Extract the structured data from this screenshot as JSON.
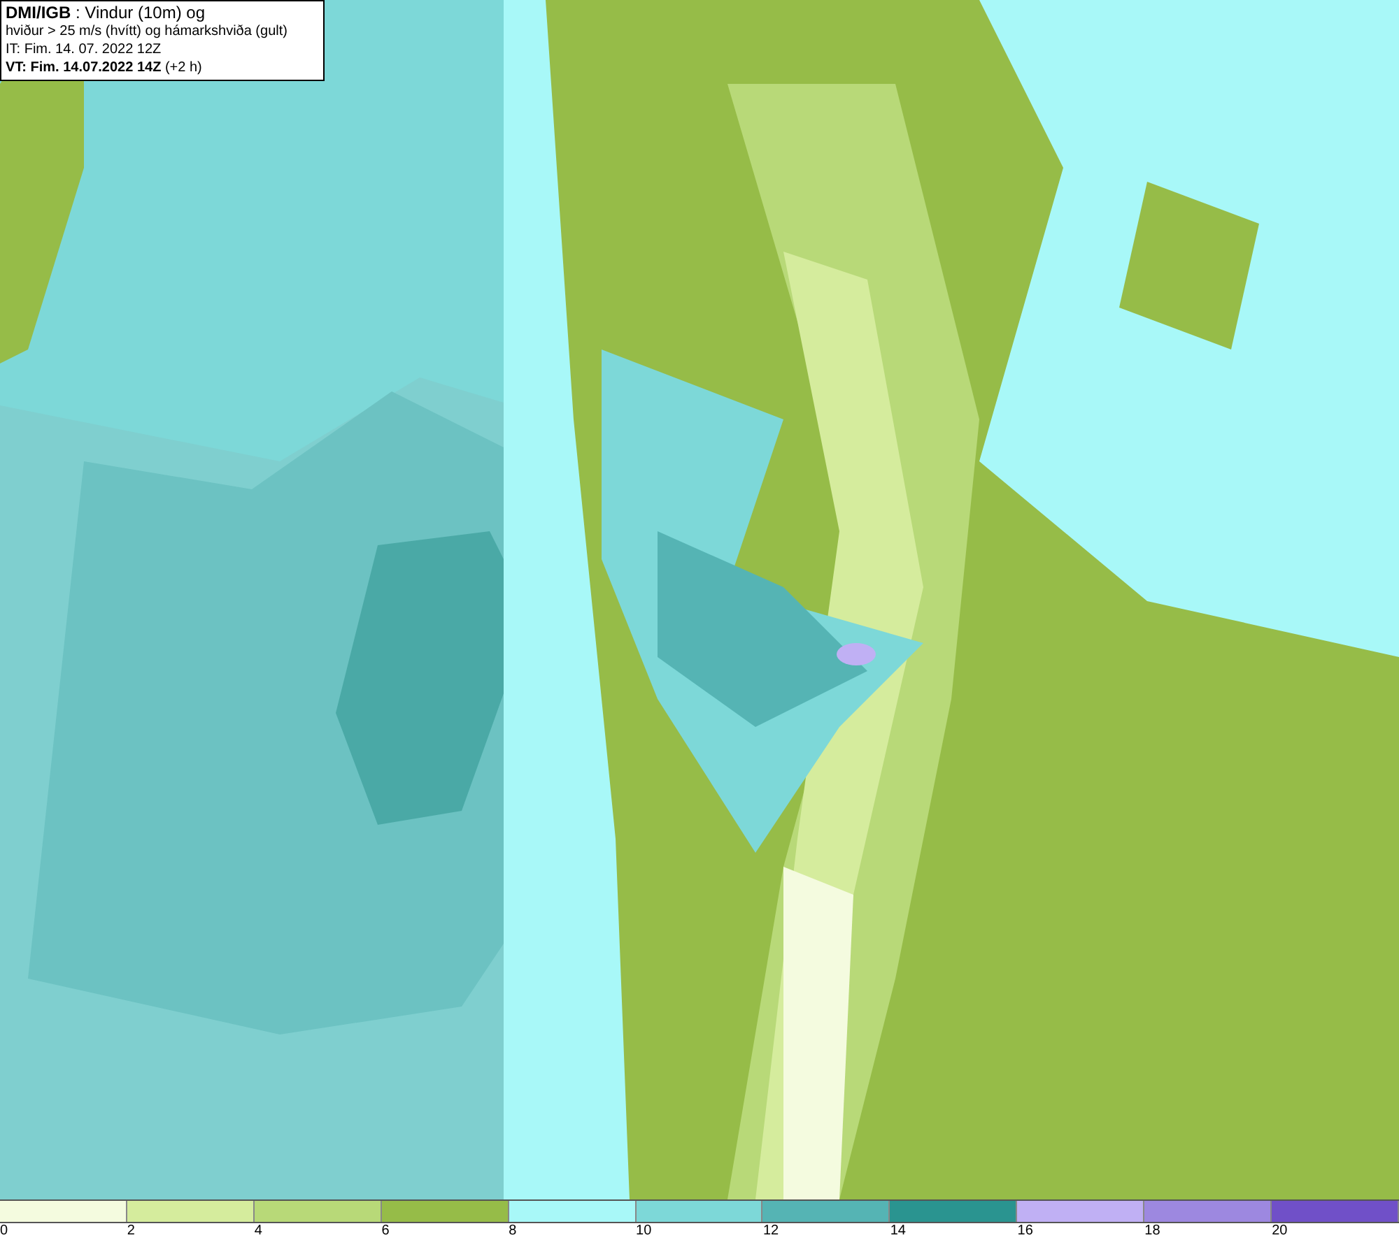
{
  "title_box": {
    "lines": [
      "**DMI/IGB** : Vindur (10m) og",
      "hviður > 25 m/s (hvítt) og hámarkshviða (gult)",
      "IT: Fim. 14. 07. 2022 12Z",
      "**VT: Fim. 14.07.2022 14Z** (+2 h)"
    ]
  },
  "legend": {
    "segments": [
      {
        "color": "#f4fbdf"
      },
      {
        "color": "#d5ec9d"
      },
      {
        "color": "#b8d978"
      },
      {
        "color": "#96bc48"
      },
      {
        "color": "#a8f8f8"
      },
      {
        "color": "#7dd8d8"
      },
      {
        "color": "#55b4b4"
      },
      {
        "color": "#2a9490"
      },
      {
        "color": "#c0b0f4"
      },
      {
        "color": "#9d88e0"
      },
      {
        "color": "#7050c8"
      }
    ],
    "ticks": [
      "0",
      "2",
      "4",
      "6",
      "8",
      "10",
      "12",
      "14",
      "16",
      "18",
      "20"
    ]
  }
}
